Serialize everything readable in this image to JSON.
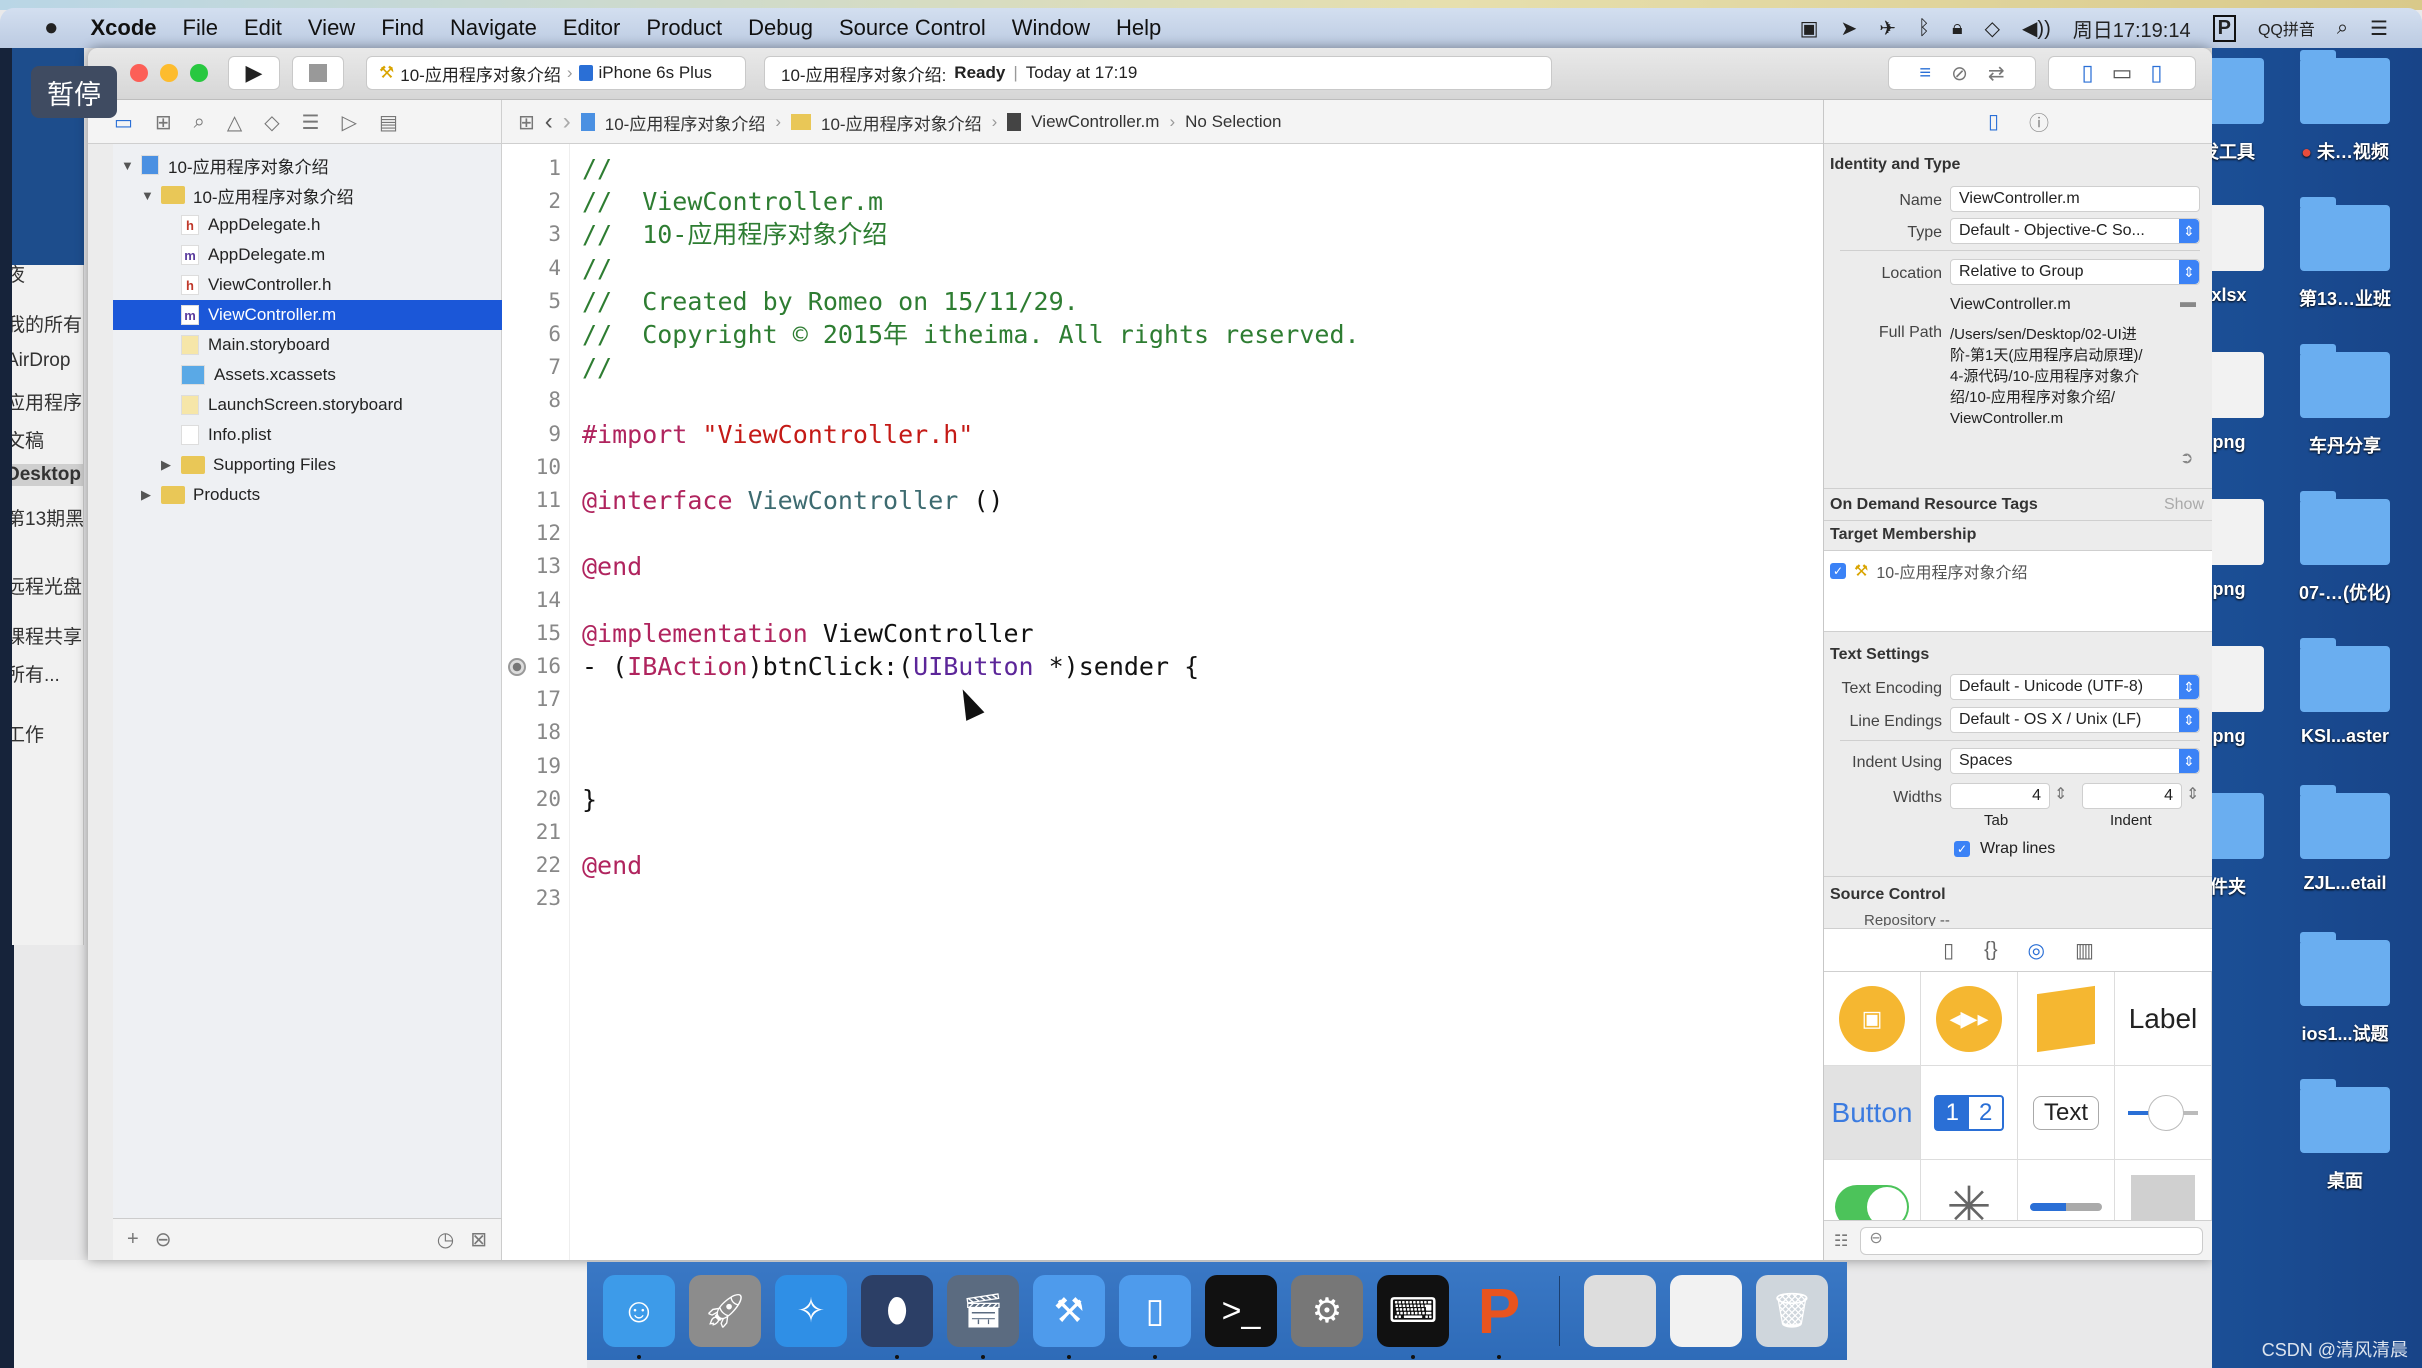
{
  "menubar": {
    "apple": "",
    "items": [
      "Xcode",
      "File",
      "Edit",
      "View",
      "Find",
      "Navigate",
      "Editor",
      "Product",
      "Debug",
      "Source Control",
      "Window",
      "Help"
    ],
    "status": {
      "clock": "周日17:19:14",
      "input_method": "QQ拼音",
      "icons": [
        "screen-record-icon",
        "location-icon",
        "airplane-icon",
        "bluetooth-icon",
        "lock-icon",
        "wifi-icon",
        "volume-icon",
        "input-method-icon",
        "spotlight-icon",
        "notification-center-icon"
      ]
    }
  },
  "overlay": {
    "pause_label": "暂停"
  },
  "finder_sidebar": {
    "items": [
      "夜",
      "我的所有",
      "AirDrop",
      "应用程序",
      "文稿",
      "Desktop",
      "第13期黑",
      "远程光盘",
      "课程共享",
      "所有...",
      "工作"
    ],
    "selected": "Desktop"
  },
  "toolbar": {
    "scheme": "10-应用程序对象介绍",
    "device": "iPhone 6s Plus",
    "activity_project": "10-应用程序对象介绍:",
    "activity_status": "Ready",
    "activity_time": "Today at 17:19"
  },
  "jumpbar": {
    "items": [
      "10-应用程序对象介绍",
      "10-应用程序对象介绍",
      "ViewController.m",
      "No Selection"
    ]
  },
  "navigator": {
    "tree": [
      {
        "label": "10-应用程序对象介绍",
        "kind": "project",
        "level": 0,
        "disclosure": "open"
      },
      {
        "label": "10-应用程序对象介绍",
        "kind": "folder",
        "level": 1,
        "disclosure": "open"
      },
      {
        "label": "AppDelegate.h",
        "kind": "h",
        "level": 2
      },
      {
        "label": "AppDelegate.m",
        "kind": "m",
        "level": 2
      },
      {
        "label": "ViewController.h",
        "kind": "h",
        "level": 2
      },
      {
        "label": "ViewController.m",
        "kind": "m",
        "level": 2,
        "selected": true
      },
      {
        "label": "Main.storyboard",
        "kind": "storyboard",
        "level": 2
      },
      {
        "label": "Assets.xcassets",
        "kind": "assets",
        "level": 2
      },
      {
        "label": "LaunchScreen.storyboard",
        "kind": "storyboard",
        "level": 2
      },
      {
        "label": "Info.plist",
        "kind": "plist",
        "level": 2
      },
      {
        "label": "Supporting Files",
        "kind": "folder",
        "level": 2,
        "disclosure": "closed"
      },
      {
        "label": "Products",
        "kind": "folder",
        "level": 1,
        "disclosure": "closed"
      }
    ]
  },
  "editor": {
    "breakpoint_line": 16,
    "lines": [
      [
        [
          "comment",
          "//"
        ]
      ],
      [
        [
          "comment",
          "//  ViewController.m"
        ]
      ],
      [
        [
          "comment",
          "//  10-应用程序对象介绍"
        ]
      ],
      [
        [
          "comment",
          "//"
        ]
      ],
      [
        [
          "comment",
          "//  Created by Romeo on 15/11/29."
        ]
      ],
      [
        [
          "comment",
          "//  Copyright © 2015年 itheima. All rights reserved."
        ]
      ],
      [
        [
          "comment",
          "//"
        ]
      ],
      [],
      [
        [
          "kw",
          "#import "
        ],
        [
          "str",
          "\"ViewController.h\""
        ]
      ],
      [],
      [
        [
          "kw",
          "@interface "
        ],
        [
          "cls",
          "ViewController"
        ],
        [
          "plain",
          " ()"
        ]
      ],
      [],
      [
        [
          "kw",
          "@end"
        ]
      ],
      [],
      [
        [
          "kw",
          "@implementation "
        ],
        [
          "plain",
          "ViewController"
        ]
      ],
      [
        [
          "plain",
          "- ("
        ],
        [
          "kw",
          "IBAction"
        ],
        [
          "plain",
          ")btnClick:("
        ],
        [
          "type",
          "UIButton"
        ],
        [
          "plain",
          " *)sender {"
        ]
      ],
      [],
      [],
      [],
      [
        [
          "plain",
          "}"
        ]
      ],
      [],
      [
        [
          "kw",
          "@end"
        ]
      ],
      []
    ]
  },
  "inspector": {
    "identity_header": "Identity and Type",
    "name_label": "Name",
    "name_value": "ViewController.m",
    "type_label": "Type",
    "type_value": "Default - Objective-C So...",
    "location_label": "Location",
    "location_value": "Relative to Group",
    "relative_path": "ViewController.m",
    "full_path_label": "Full Path",
    "full_path_lines": [
      "/Users/sen/Desktop/02-UI进",
      "阶-第1天(应用程序启动原理)/",
      "4-源代码/10-应用程序对象介",
      "绍/10-应用程序对象介绍/",
      "ViewController.m"
    ],
    "odr_header": "On Demand Resource Tags",
    "odr_show": "Show",
    "target_header": "Target Membership",
    "target_name": "10-应用程序对象介绍",
    "target_checked": true,
    "text_header": "Text Settings",
    "encoding_label": "Text Encoding",
    "encoding_value": "Default - Unicode (UTF-8)",
    "endings_label": "Line Endings",
    "endings_value": "Default - OS X / Unix (LF)",
    "indent_label": "Indent Using",
    "indent_value": "Spaces",
    "widths_label": "Widths",
    "tab_value": "4",
    "indent_width_value": "4",
    "tab_caption": "Tab",
    "indent_caption": "Indent",
    "wrap_label": "Wrap lines",
    "wrap_checked": true,
    "sc_header": "Source Control",
    "repo_label": "Repository",
    "repo_value": "--"
  },
  "library": {
    "tabs": [
      "file-template-icon",
      "code-snippet-icon",
      "object-library-icon",
      "media-library-icon"
    ],
    "active_tab": 2,
    "items": [
      "camera-object",
      "media-player-object",
      "cube-object",
      "Label",
      "Button",
      "segmented-control",
      "Text",
      "slider",
      "switch",
      "activity-indicator",
      "progress-view",
      "page-control",
      "",
      "",
      "",
      ""
    ],
    "segment_labels": [
      "1",
      "2"
    ]
  },
  "desktop": {
    "items": [
      {
        "label": "开发工具",
        "col": 0
      },
      {
        "label": "未…视频",
        "col": 1,
        "tag": "#e74c3c"
      },
      {
        "label": "....xlsx",
        "col": 0
      },
      {
        "label": "第13…业班",
        "col": 1
      },
      {
        "label": "....png",
        "col": 0
      },
      {
        "label": "车丹分享",
        "col": 1
      },
      {
        "label": "....png",
        "col": 0
      },
      {
        "label": "07-…(优化)",
        "col": 1
      },
      {
        "label": "....png",
        "col": 0
      },
      {
        "label": "KSI...aster",
        "col": 1
      },
      {
        "label": "…件夹",
        "col": 0
      },
      {
        "label": "ZJL...etail",
        "col": 1
      },
      {
        "label": "ios1...试题",
        "col": 1
      },
      {
        "label": "桌面",
        "col": 1
      }
    ]
  },
  "dock": {
    "items": [
      {
        "name": "finder",
        "running": true
      },
      {
        "name": "launchpad",
        "running": false
      },
      {
        "name": "safari",
        "running": false
      },
      {
        "name": "mouse-app",
        "running": true
      },
      {
        "name": "video-app",
        "running": true
      },
      {
        "name": "xcode",
        "running": true
      },
      {
        "name": "simulator",
        "running": true
      },
      {
        "name": "terminal",
        "running": false
      },
      {
        "name": "system-preferences",
        "running": false
      },
      {
        "name": "console",
        "running": true
      },
      {
        "name": "wps-presentation",
        "running": true
      },
      {
        "name": "separator"
      },
      {
        "name": "window-thumbnail-1"
      },
      {
        "name": "window-thumbnail-2"
      },
      {
        "name": "trash"
      }
    ]
  },
  "watermark": "CSDN @清风清晨",
  "colors": {
    "selection": "#1b57d8",
    "accent": "#3b82f6",
    "comment": "#2e7d32",
    "keyword": "#b0245e",
    "string": "#c41a16",
    "desktop": "#1b4f96"
  }
}
